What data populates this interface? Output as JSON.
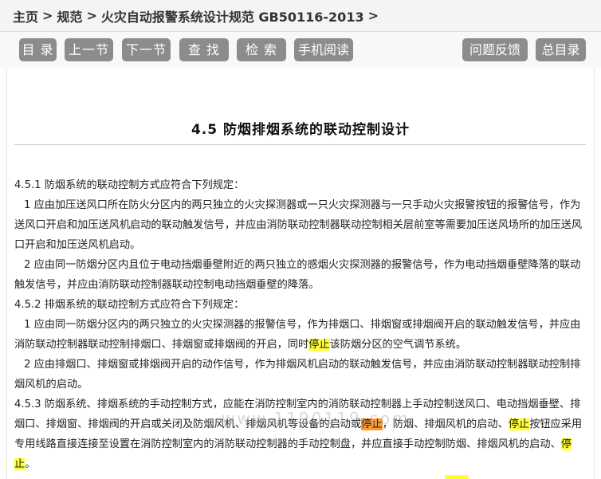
{
  "breadcrumb": {
    "home": "主页",
    "sep": ">",
    "section": "规范",
    "doc": "火灾自动报警系统设计规范 GB50116-2013"
  },
  "toolbar": {
    "catalog": "目 录",
    "prev": "上一节",
    "next": "下一节",
    "find": "查 找",
    "search": "检 索",
    "mobile": "手机阅读",
    "feedback": "问题反馈",
    "index": "总目录"
  },
  "page": {
    "title": "4.5 防烟排烟系统的联动控制设计"
  },
  "article": {
    "p1": "4.5.1 防烟系统的联动控制方式应符合下列规定：",
    "p2": "1 应由加压送风口所在防火分区内的两只独立的火灾探测器或一只火灾探测器与一只手动火灾报警按钮的报警信号，作为送风口开启和加压送风机启动的联动触发信号，并应由消防联动控制器联动控制相关层前室等需要加压送风场所的加压送风口开启和加压送风机启动。",
    "p3": "2 应由同一防烟分区内且位于电动挡烟垂壁附近的两只独立的感烟火灾探测器的报警信号，作为电动挡烟垂壁降落的联动触发信号，并应由消防联动控制器联动控制电动挡烟垂壁的降落。",
    "p4": "4.5.2 排烟系统的联动控制方式应符合下列规定：",
    "p5a": "1 应由同一防烟分区内的两只独立的火灾探测器的报警信号，作为排烟口、排烟窗或排烟阀开启的联动触发信号，并应由消防联动控制器联动控制排烟口、排烟窗或排烟阀的开启，同时",
    "p5hl": "停止",
    "p5b": "该防烟分区的空气调节系统。",
    "p6": "2 应由排烟口、排烟窗或排烟阀开启的动作信号，作为排烟风机启动的联动触发信号，并应由消防联动控制器联动控制排烟风机的启动。",
    "p7a": "4.5.3 防烟系统、排烟系统的手动控制方式，应能在消防控制室内的消防联动控制器上手动控制送风口、电动挡烟垂壁、排烟口、排烟窗、排烟阀的开启或关闭及防烟风机、排烟风机等设备的启动或",
    "p7hl1": "停止",
    "p7b": "，防烟、排烟风机的启动、",
    "p7hl2": "停止",
    "p7c": "按钮应采用专用线路直接连接至设置在消防控制室内的消防联动控制器的手动控制盘，并应直接手动控制防烟、排烟风机的启动、",
    "p7hl3": "停止",
    "p7d": "。"
  },
  "watermark": "www.1190119.com",
  "colors": {
    "button_bg": "#8c8c8c",
    "highlight": "#ffff33",
    "highlight_active": "#ff9933"
  }
}
